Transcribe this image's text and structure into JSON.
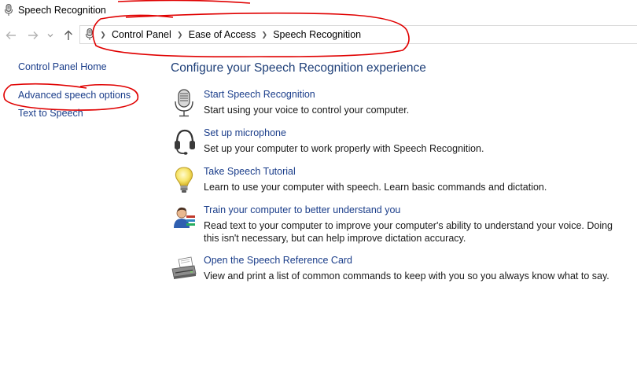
{
  "window": {
    "title": "Speech Recognition"
  },
  "nav": {
    "back_glyph": "←",
    "forward_glyph": "→",
    "recent_glyph": "⌄",
    "up_glyph": "↑"
  },
  "breadcrumb": [
    "Control Panel",
    "Ease of Access",
    "Speech Recognition"
  ],
  "sidebar": {
    "items": [
      {
        "label": "Control Panel Home"
      },
      {
        "label": "Advanced speech options"
      },
      {
        "label": "Text to Speech"
      }
    ]
  },
  "main": {
    "title": "Configure your Speech Recognition experience",
    "tasks": [
      {
        "icon": "microphone-icon",
        "link": "Start Speech Recognition",
        "desc": "Start using your voice to control your computer."
      },
      {
        "icon": "headset-icon",
        "link": "Set up microphone",
        "desc": "Set up your computer to work properly with Speech Recognition."
      },
      {
        "icon": "lightbulb-icon",
        "link": "Take Speech Tutorial",
        "desc": "Learn to use your computer with speech.  Learn basic commands and dictation."
      },
      {
        "icon": "person-training-icon",
        "link": "Train your computer to better understand you",
        "desc": "Read text to your computer to improve your computer's ability to understand your voice.  Doing this isn't necessary, but can help improve dictation accuracy."
      },
      {
        "icon": "printer-icon",
        "link": "Open the Speech Reference Card",
        "desc": "View and print a list of common commands to keep with you so you always know what to say."
      }
    ]
  },
  "colors": {
    "link": "#1a3d8a",
    "heading": "#1e3f78",
    "annotation": "#e00000"
  }
}
